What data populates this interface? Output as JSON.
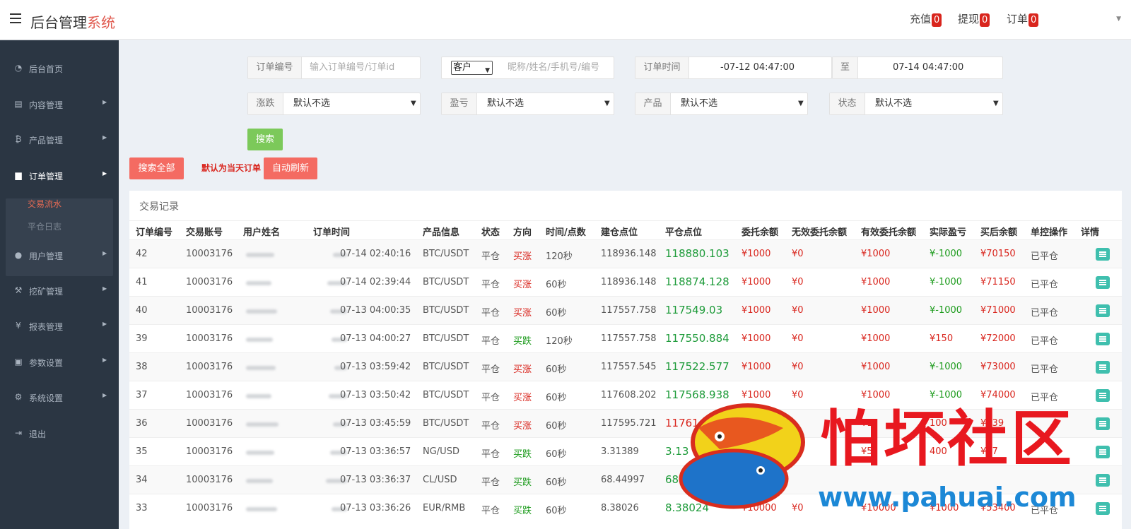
{
  "header": {
    "logo_main": "后台管理",
    "logo_accent": "系统",
    "recharge_label": "充值",
    "recharge_count": "0",
    "withdraw_label": "提现",
    "withdraw_count": "0",
    "order_label": "订单",
    "order_count": "0"
  },
  "sidebar": {
    "items": [
      {
        "icon": "dashboard-icon",
        "label": "后台首页"
      },
      {
        "icon": "book-icon",
        "label": "内容管理"
      },
      {
        "icon": "bitcoin-icon",
        "label": "产品管理"
      },
      {
        "icon": "file-icon",
        "label": "订单管理"
      },
      {
        "icon": "user-icon",
        "label": "用户管理"
      },
      {
        "icon": "pickaxe-icon",
        "label": "挖矿管理"
      },
      {
        "icon": "yen-icon",
        "label": "报表管理"
      },
      {
        "icon": "copy-icon",
        "label": "参数设置"
      },
      {
        "icon": "gears-icon",
        "label": "系统设置"
      },
      {
        "icon": "logout-icon",
        "label": "退出"
      }
    ],
    "sub_items": [
      {
        "label": "交易流水"
      },
      {
        "label": "平仓日志"
      }
    ]
  },
  "search": {
    "order_no_label": "订单编号",
    "order_no_placeholder": "输入订单编号/订单id",
    "customer_select": "客户",
    "customer_placeholder": "昵称/姓名/手机号/编号",
    "order_time_label": "订单时间",
    "time_start": "-07-12 04:47:00",
    "time_to_label": "至",
    "time_end": "07-14 04:47:00",
    "rise_fall_label": "涨跌",
    "rise_fall_value": "默认不选",
    "profit_label": "盈亏",
    "profit_value": "默认不选",
    "product_label": "产品",
    "product_value": "默认不选",
    "status_label": "状态",
    "status_value": "默认不选",
    "search_button": "搜索",
    "search_all_button": "搜索全部",
    "notice": "默认为当天订单",
    "auto_refresh_button": "自动刷新"
  },
  "table": {
    "title": "交易记录",
    "columns": [
      "订单编号",
      "交易账号",
      "用户姓名",
      "订单时间",
      "产品信息",
      "状态",
      "方向",
      "时间/点数",
      "建仓点位",
      "平仓点位",
      "委托余额",
      "无效委托余额",
      "有效委托余额",
      "实际盈亏",
      "买后余额",
      "单控操作",
      "详情"
    ],
    "rows": [
      {
        "id": "42",
        "account": "10003176",
        "time": "07-14 02:40:16",
        "product": "BTC/USDT",
        "status": "平仓",
        "dir": "买涨",
        "dur": "120秒",
        "open": "118936.148",
        "close": "118880.103",
        "close_color": "green",
        "entrust": "¥1000",
        "invalid": "¥0",
        "valid": "¥1000",
        "pnl": "¥-1000",
        "pnl_color": "green",
        "after": "¥70150",
        "ctrl": "已平仓"
      },
      {
        "id": "41",
        "account": "10003176",
        "time": "07-14 02:39:44",
        "product": "BTC/USDT",
        "status": "平仓",
        "dir": "买涨",
        "dur": "60秒",
        "open": "118936.148",
        "close": "118874.128",
        "close_color": "green",
        "entrust": "¥1000",
        "invalid": "¥0",
        "valid": "¥1000",
        "pnl": "¥-1000",
        "pnl_color": "green",
        "after": "¥71150",
        "ctrl": "已平仓"
      },
      {
        "id": "40",
        "account": "10003176",
        "time": "07-13 04:00:35",
        "product": "BTC/USDT",
        "status": "平仓",
        "dir": "买涨",
        "dur": "60秒",
        "open": "117557.758",
        "close": "117549.03",
        "close_color": "green",
        "entrust": "¥1000",
        "invalid": "¥0",
        "valid": "¥1000",
        "pnl": "¥-1000",
        "pnl_color": "green",
        "after": "¥71000",
        "ctrl": "已平仓"
      },
      {
        "id": "39",
        "account": "10003176",
        "time": "07-13 04:00:27",
        "product": "BTC/USDT",
        "status": "平仓",
        "dir": "买跌",
        "dur": "120秒",
        "open": "117557.758",
        "close": "117550.884",
        "close_color": "green",
        "entrust": "¥1000",
        "invalid": "¥0",
        "valid": "¥1000",
        "pnl": "¥150",
        "pnl_color": "red",
        "after": "¥72000",
        "ctrl": "已平仓"
      },
      {
        "id": "38",
        "account": "10003176",
        "time": "07-13 03:59:42",
        "product": "BTC/USDT",
        "status": "平仓",
        "dir": "买涨",
        "dur": "60秒",
        "open": "117557.545",
        "close": "117522.577",
        "close_color": "green",
        "entrust": "¥1000",
        "invalid": "¥0",
        "valid": "¥1000",
        "pnl": "¥-1000",
        "pnl_color": "green",
        "after": "¥73000",
        "ctrl": "已平仓"
      },
      {
        "id": "37",
        "account": "10003176",
        "time": "07-13 03:50:42",
        "product": "BTC/USDT",
        "status": "平仓",
        "dir": "买涨",
        "dur": "60秒",
        "open": "117608.202",
        "close": "117568.938",
        "close_color": "green",
        "entrust": "¥1000",
        "invalid": "¥0",
        "valid": "¥1000",
        "pnl": "¥-1000",
        "pnl_color": "green",
        "after": "¥74000",
        "ctrl": "已平仓"
      },
      {
        "id": "36",
        "account": "10003176",
        "time": "07-13 03:45:59",
        "product": "BTC/USDT",
        "status": "平仓",
        "dir": "买涨",
        "dur": "60秒",
        "open": "117595.721",
        "close": "11761",
        "close_color": "red",
        "entrust": "",
        "invalid": "",
        "valid": "¥1",
        "pnl": "100",
        "pnl_color": "red",
        "after": "¥739",
        "ctrl": ""
      },
      {
        "id": "35",
        "account": "10003176",
        "time": "07-13 03:36:57",
        "product": "NG/USD",
        "status": "平仓",
        "dir": "买跌",
        "dur": "60秒",
        "open": "3.31389",
        "close": "3.13",
        "close_color": "green",
        "entrust": "",
        "invalid": "",
        "valid": "¥5",
        "pnl": "400",
        "pnl_color": "red",
        "after": "¥47",
        "ctrl": ""
      },
      {
        "id": "34",
        "account": "10003176",
        "time": "07-13 03:36:37",
        "product": "CL/USD",
        "status": "平仓",
        "dir": "买跌",
        "dur": "60秒",
        "open": "68.44997",
        "close": "68.2",
        "close_color": "green",
        "entrust": "",
        "invalid": "",
        "valid": "",
        "pnl": "",
        "pnl_color": "red",
        "after": "",
        "ctrl": ""
      },
      {
        "id": "33",
        "account": "10003176",
        "time": "07-13 03:36:26",
        "product": "EUR/RMB",
        "status": "平仓",
        "dir": "买跌",
        "dur": "60秒",
        "open": "8.38026",
        "close": "8.38024",
        "close_color": "green",
        "entrust": "¥10000",
        "invalid": "¥0",
        "valid": "¥10000",
        "pnl": "¥1000",
        "pnl_color": "red",
        "after": "¥53400",
        "ctrl": "已平仓"
      }
    ]
  },
  "watermark": {
    "text": "怕坏社区",
    "url": "www.pahuai.com"
  },
  "colors": {
    "sidebar_bg": "#2b3643",
    "accent_red": "#d9251d",
    "profit_green": "#1e9b3a",
    "button_green": "#7cc95a",
    "button_red": "#f46b62",
    "detail_teal": "#3fbfae"
  }
}
